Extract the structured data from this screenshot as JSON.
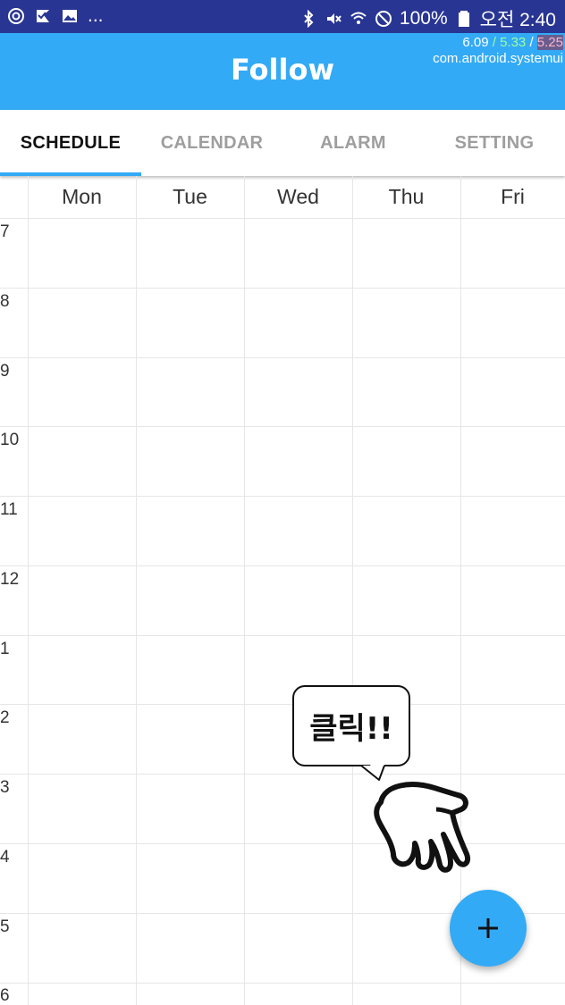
{
  "status_bar": {
    "left_more": "...",
    "battery": "100%",
    "time": "오전 2:40",
    "icons_left": [
      "target-icon",
      "check-flag-icon",
      "image-icon"
    ],
    "icons_right": [
      "bluetooth-icon",
      "mute-icon",
      "wifi-icon",
      "do-not-disturb-icon",
      "battery-icon"
    ]
  },
  "debug_overlay": {
    "v1": "6.09",
    "sep1": " / ",
    "v2": "5.33",
    "sep2": " / ",
    "v3": "5.25",
    "process": "com.android.systemui"
  },
  "app_bar": {
    "title": "Follow"
  },
  "tabs": [
    {
      "label": "SCHEDULE",
      "active": true
    },
    {
      "label": "CALENDAR",
      "active": false
    },
    {
      "label": "ALARM",
      "active": false
    },
    {
      "label": "SETTING",
      "active": false
    }
  ],
  "timetable": {
    "days": [
      "Mon",
      "Tue",
      "Wed",
      "Thu",
      "Fri"
    ],
    "hours": [
      "7",
      "8",
      "9",
      "10",
      "11",
      "12",
      "1",
      "2",
      "3",
      "4",
      "5",
      "6"
    ]
  },
  "hint": {
    "text": "클릭!!"
  },
  "fab": {
    "icon": "plus-icon",
    "color": "#33aaf6"
  },
  "colors": {
    "status_bar": "#283593",
    "accent": "#33aaf6"
  }
}
